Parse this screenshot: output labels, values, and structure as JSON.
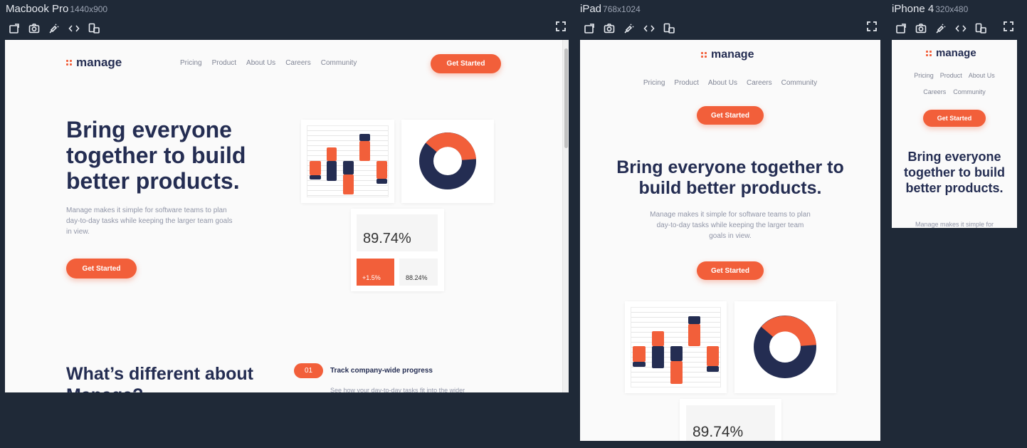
{
  "devices": [
    {
      "name": "Macbook Pro",
      "size": "1440x900"
    },
    {
      "name": "iPad",
      "size": "768x1024"
    },
    {
      "name": "iPhone 4",
      "size": "320x480"
    }
  ],
  "site": {
    "logo": "manage",
    "nav": [
      "Pricing",
      "Product",
      "About Us",
      "Careers",
      "Community"
    ],
    "cta": "Get Started",
    "headline": "Bring everyone together to build better products.",
    "description": "Manage makes it simple for software teams to plan day-to-day tasks while keeping the larger team goals in view.",
    "mobile_description_visible": "Manage makes it simple for",
    "section_title": "What’s different about Manage?",
    "feature": {
      "number": "01",
      "title": "Track company-wide progress",
      "text_visible": "See how your day-to-day tasks fit into the wider"
    },
    "stats": {
      "main": "89.74%",
      "change": "+1.5%",
      "secondary": "88.24%"
    }
  },
  "colors": {
    "accent": "#f25f3a",
    "navy": "#242d52",
    "muted": "#9095a7",
    "background": "#fafafa"
  }
}
